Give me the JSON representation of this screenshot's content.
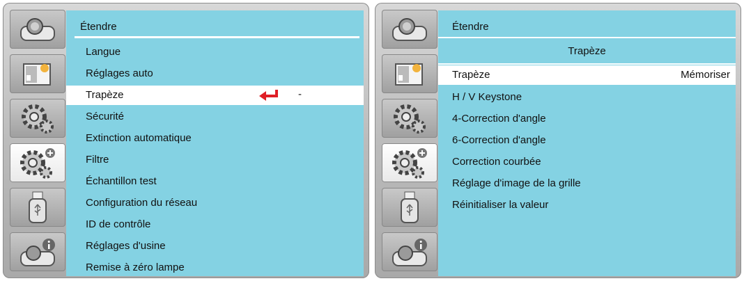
{
  "left_screen": {
    "header_title": "Étendre",
    "items": [
      {
        "label": "Langue"
      },
      {
        "label": "Réglages auto"
      },
      {
        "label": "Trapèze",
        "selected": true,
        "value": "-"
      },
      {
        "label": "Sécurité"
      },
      {
        "label": "Extinction automatique"
      },
      {
        "label": "Filtre"
      },
      {
        "label": "Échantillon test"
      },
      {
        "label": "Configuration du réseau"
      },
      {
        "label": "ID de contrôle"
      },
      {
        "label": "Réglages d'usine"
      },
      {
        "label": "Remise à zéro lampe"
      }
    ]
  },
  "right_screen": {
    "header_title": "Étendre",
    "subtitle": "Trapèze",
    "items": [
      {
        "label": "Trapèze",
        "selected": true,
        "value": "Mémoriser"
      },
      {
        "label": "H / V Keystone"
      },
      {
        "label": "4-Correction d'angle"
      },
      {
        "label": "6-Correction d'angle"
      },
      {
        "label": "Correction courbée"
      },
      {
        "label": "Réglage d'image de la grille"
      },
      {
        "label": "Réinitialiser la valeur"
      }
    ]
  },
  "sidebar_icons": [
    "projector-icon",
    "picture-adjust-icon",
    "settings-gear-icon",
    "extended-settings-gear-plus-icon",
    "usb-icon",
    "info-projector-icon"
  ],
  "active_sidebar_index": 3,
  "colors": {
    "panel_bg": "#84d2e3",
    "selected_row_bg": "#ffffff",
    "enter_arrow": "#e01f26"
  }
}
